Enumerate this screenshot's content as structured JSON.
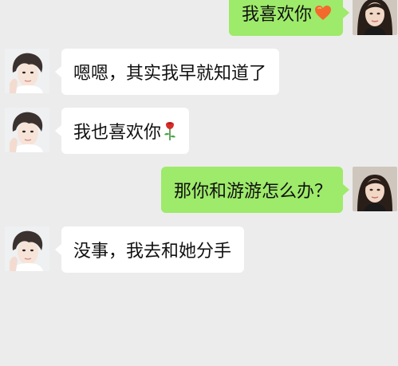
{
  "chat": {
    "messages": [
      {
        "side": "right",
        "text": "我喜欢你",
        "emoji": "orange-heart-icon"
      },
      {
        "side": "left",
        "text": "嗯嗯，其实我早就知道了"
      },
      {
        "side": "left",
        "text": "我也喜欢你",
        "emoji": "rose-icon"
      },
      {
        "side": "right",
        "text": "那你和游游怎么办？"
      },
      {
        "side": "left",
        "text": "没事，我去和她分手"
      }
    ]
  },
  "colors": {
    "background": "#ececec",
    "sent_bubble": "#9eea6a",
    "received_bubble": "#ffffff",
    "heart": "#f26b2c",
    "rose": "#d92b2b"
  }
}
